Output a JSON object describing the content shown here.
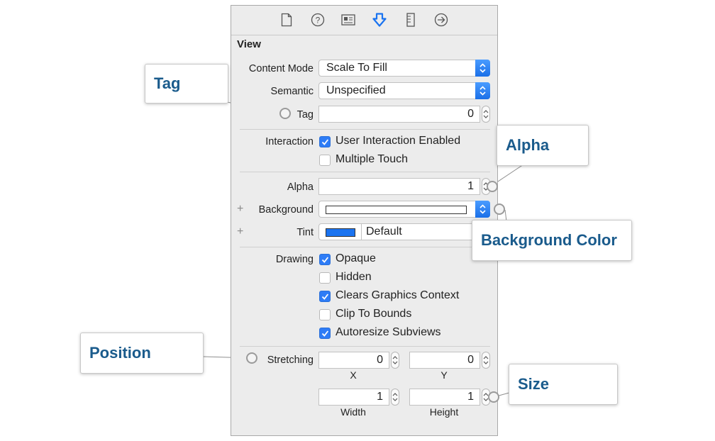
{
  "toolbar": {
    "icons": [
      "file-inspector-icon",
      "quick-help-icon",
      "identity-inspector-icon",
      "attributes-inspector-icon",
      "size-inspector-icon",
      "connections-inspector-icon"
    ]
  },
  "section": {
    "title": "View"
  },
  "content_mode": {
    "label": "Content Mode",
    "value": "Scale To Fill"
  },
  "semantic": {
    "label": "Semantic",
    "value": "Unspecified"
  },
  "tag": {
    "label": "Tag",
    "value": "0"
  },
  "interaction": {
    "label": "Interaction",
    "options": [
      {
        "text": "User Interaction Enabled",
        "checked": true
      },
      {
        "text": "Multiple Touch",
        "checked": false
      }
    ]
  },
  "alpha": {
    "label": "Alpha",
    "value": "1"
  },
  "background": {
    "plus": "+",
    "label": "Background"
  },
  "tint": {
    "plus": "+",
    "label": "Tint",
    "value": "Default",
    "swatch_color": "#1a73f0"
  },
  "drawing": {
    "label": "Drawing",
    "options": [
      {
        "text": "Opaque",
        "checked": true
      },
      {
        "text": "Hidden",
        "checked": false
      },
      {
        "text": "Clears Graphics Context",
        "checked": true
      },
      {
        "text": "Clip To Bounds",
        "checked": false
      },
      {
        "text": "Autoresize Subviews",
        "checked": true
      }
    ]
  },
  "stretching": {
    "label": "Stretching",
    "x": {
      "value": "0",
      "caption": "X"
    },
    "y": {
      "value": "0",
      "caption": "Y"
    },
    "width": {
      "value": "1",
      "caption": "Width"
    },
    "height": {
      "value": "1",
      "caption": "Height"
    }
  },
  "callouts": {
    "tag": "Tag",
    "alpha": "Alpha",
    "background_color": "Background Color",
    "position": "Position",
    "size": "Size"
  },
  "colors": {
    "accent": "#2e7cf6",
    "callout_text": "#1a5b8c",
    "panel_bg": "#ececec"
  }
}
